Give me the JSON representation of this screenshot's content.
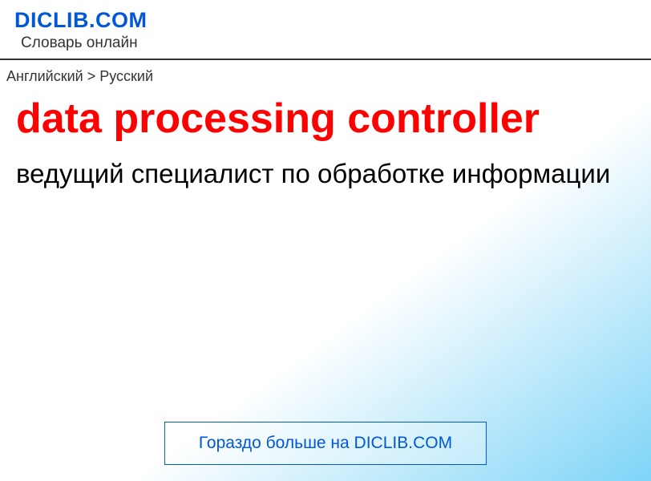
{
  "header": {
    "site_name": "DICLIB.COM",
    "site_subtitle": "Словарь онлайн"
  },
  "breadcrumb": {
    "text": "Английский > Русский"
  },
  "entry": {
    "term": "data processing controller",
    "translation": "ведущий специалист по обработке информации"
  },
  "footer": {
    "more_label": "Гораздо больше на DICLIB.COM"
  }
}
